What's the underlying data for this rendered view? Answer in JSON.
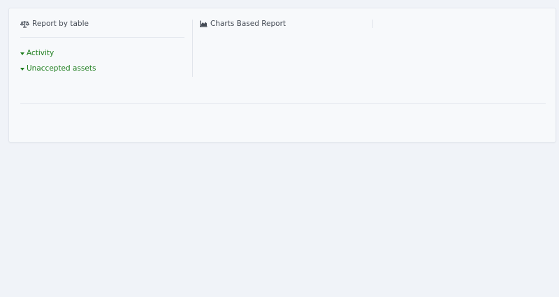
{
  "report_table": {
    "title": "Report by table",
    "icon": "scale-balance-icon",
    "links": [
      {
        "label": "Activity",
        "icon": "caret-down-icon"
      },
      {
        "label": "Unaccepted assets",
        "icon": "caret-down-icon"
      }
    ]
  },
  "charts": {
    "title": "Charts Based Report",
    "icon": "area-chart-icon"
  },
  "colors": {
    "page_bg": "#f0f3f8",
    "card_bg": "#f7f9fb",
    "link": "#1e7e1e",
    "heading": "#444b55"
  }
}
